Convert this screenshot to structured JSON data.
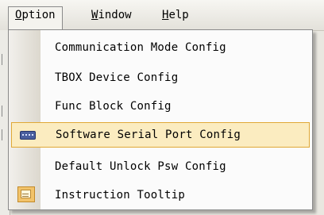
{
  "menubar": {
    "items": [
      {
        "mnemonic": "O",
        "rest": "ption",
        "active": true
      },
      {
        "mnemonic": "W",
        "rest": "indow",
        "active": false
      },
      {
        "mnemonic": "H",
        "rest": "elp",
        "active": false
      }
    ]
  },
  "menu": {
    "items": [
      {
        "label": "Communication Mode Config",
        "highlighted": false,
        "icon": null
      },
      {
        "label": "TBOX Device Config",
        "highlighted": false,
        "icon": null
      },
      {
        "label": "Func Block Config",
        "highlighted": false,
        "icon": null
      },
      {
        "label": "Software Serial Port Config",
        "highlighted": true,
        "icon": "serial-port-icon"
      },
      {
        "label": "Default Unlock Psw Config",
        "highlighted": false,
        "icon": null
      },
      {
        "label": "Instruction Tooltip",
        "highlighted": false,
        "icon": "tooltip-icon"
      }
    ]
  },
  "colors": {
    "highlight_fill": "#fbecc0",
    "highlight_border": "#e0a836"
  }
}
